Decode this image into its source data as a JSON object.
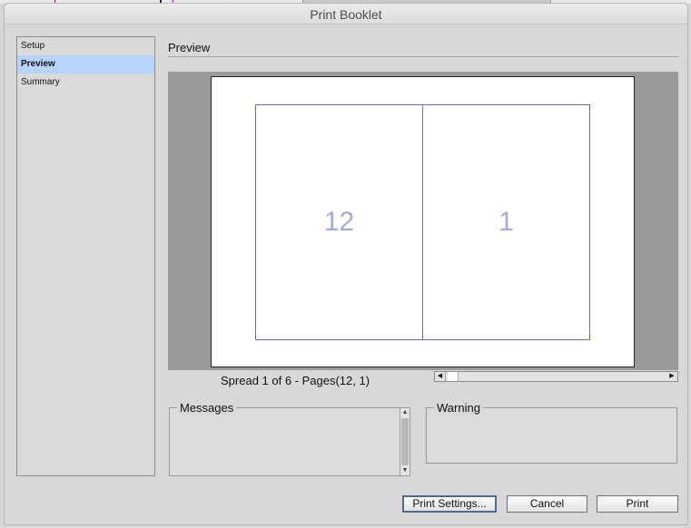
{
  "window": {
    "title": "Print Booklet"
  },
  "sidebar": {
    "items": [
      {
        "label": "Setup",
        "selected": false
      },
      {
        "label": "Preview",
        "selected": true
      },
      {
        "label": "Summary",
        "selected": false
      }
    ]
  },
  "panel": {
    "title": "Preview",
    "spread": {
      "left_page": "12",
      "right_page": "1",
      "label": "Spread 1 of 6 - Pages(12, 1)"
    }
  },
  "groups": {
    "messages": {
      "label": "Messages"
    },
    "warning": {
      "label": "Warning"
    }
  },
  "buttons": {
    "print_settings": "Print Settings...",
    "cancel": "Cancel",
    "print": "Print"
  },
  "icons": {
    "scroll_left": "◀",
    "scroll_right": "▶",
    "scroll_up": "▲",
    "scroll_down": "▼"
  },
  "colors": {
    "selection": "#b4d4fe",
    "page_outline": "#6a6acf",
    "page_number": "#a8a8df",
    "preview_bg": "#9a9a9a"
  }
}
